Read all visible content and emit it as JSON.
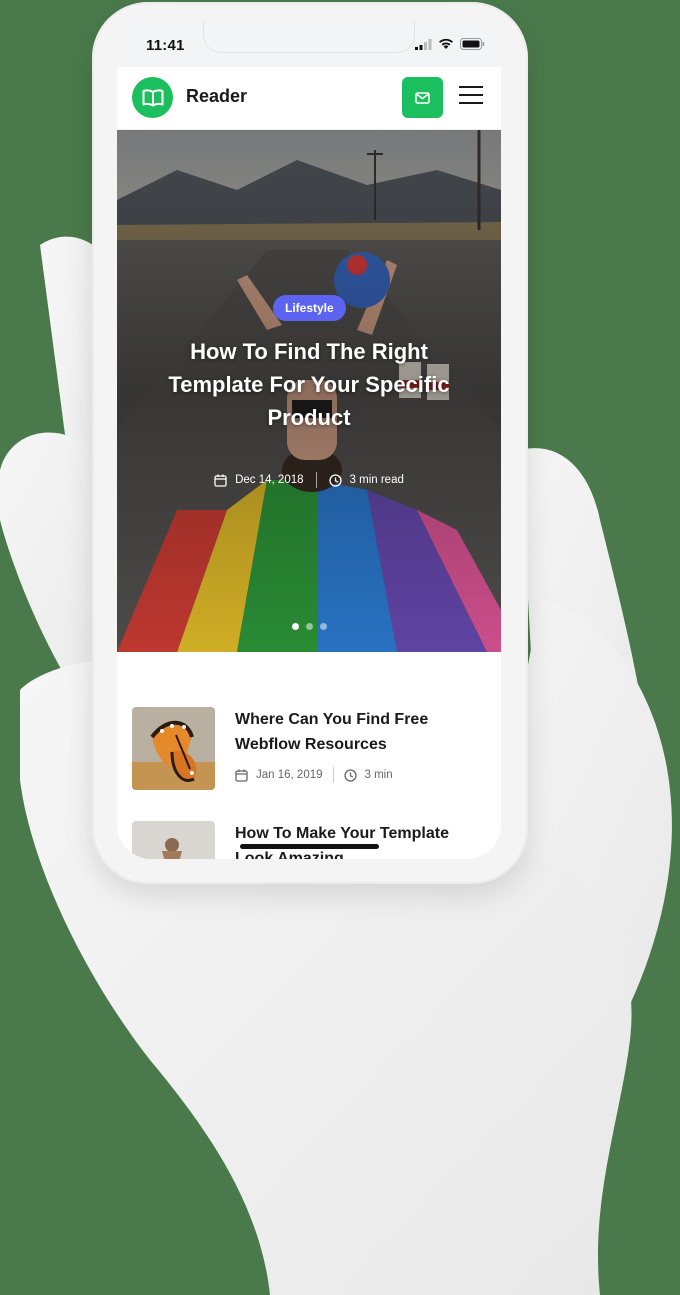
{
  "status_bar": {
    "time": "11:41"
  },
  "nav": {
    "brand": "Reader"
  },
  "hero": {
    "category": "Lifestyle",
    "title": "How To Find The Right Template For Your Specific Product",
    "date": "Dec 14, 2018",
    "read_time": "3 min read",
    "slides": 3,
    "active_slide": 1
  },
  "posts": [
    {
      "title": "Where Can You Find Free Webflow Resources",
      "date": "Jan 16, 2019",
      "read_time": "3 min"
    },
    {
      "title": "How To Make Your Template Look Amazing"
    }
  ],
  "colors": {
    "accent": "#1cbf5d",
    "badge": "#5b63f0",
    "background": "#4a7a4b"
  }
}
